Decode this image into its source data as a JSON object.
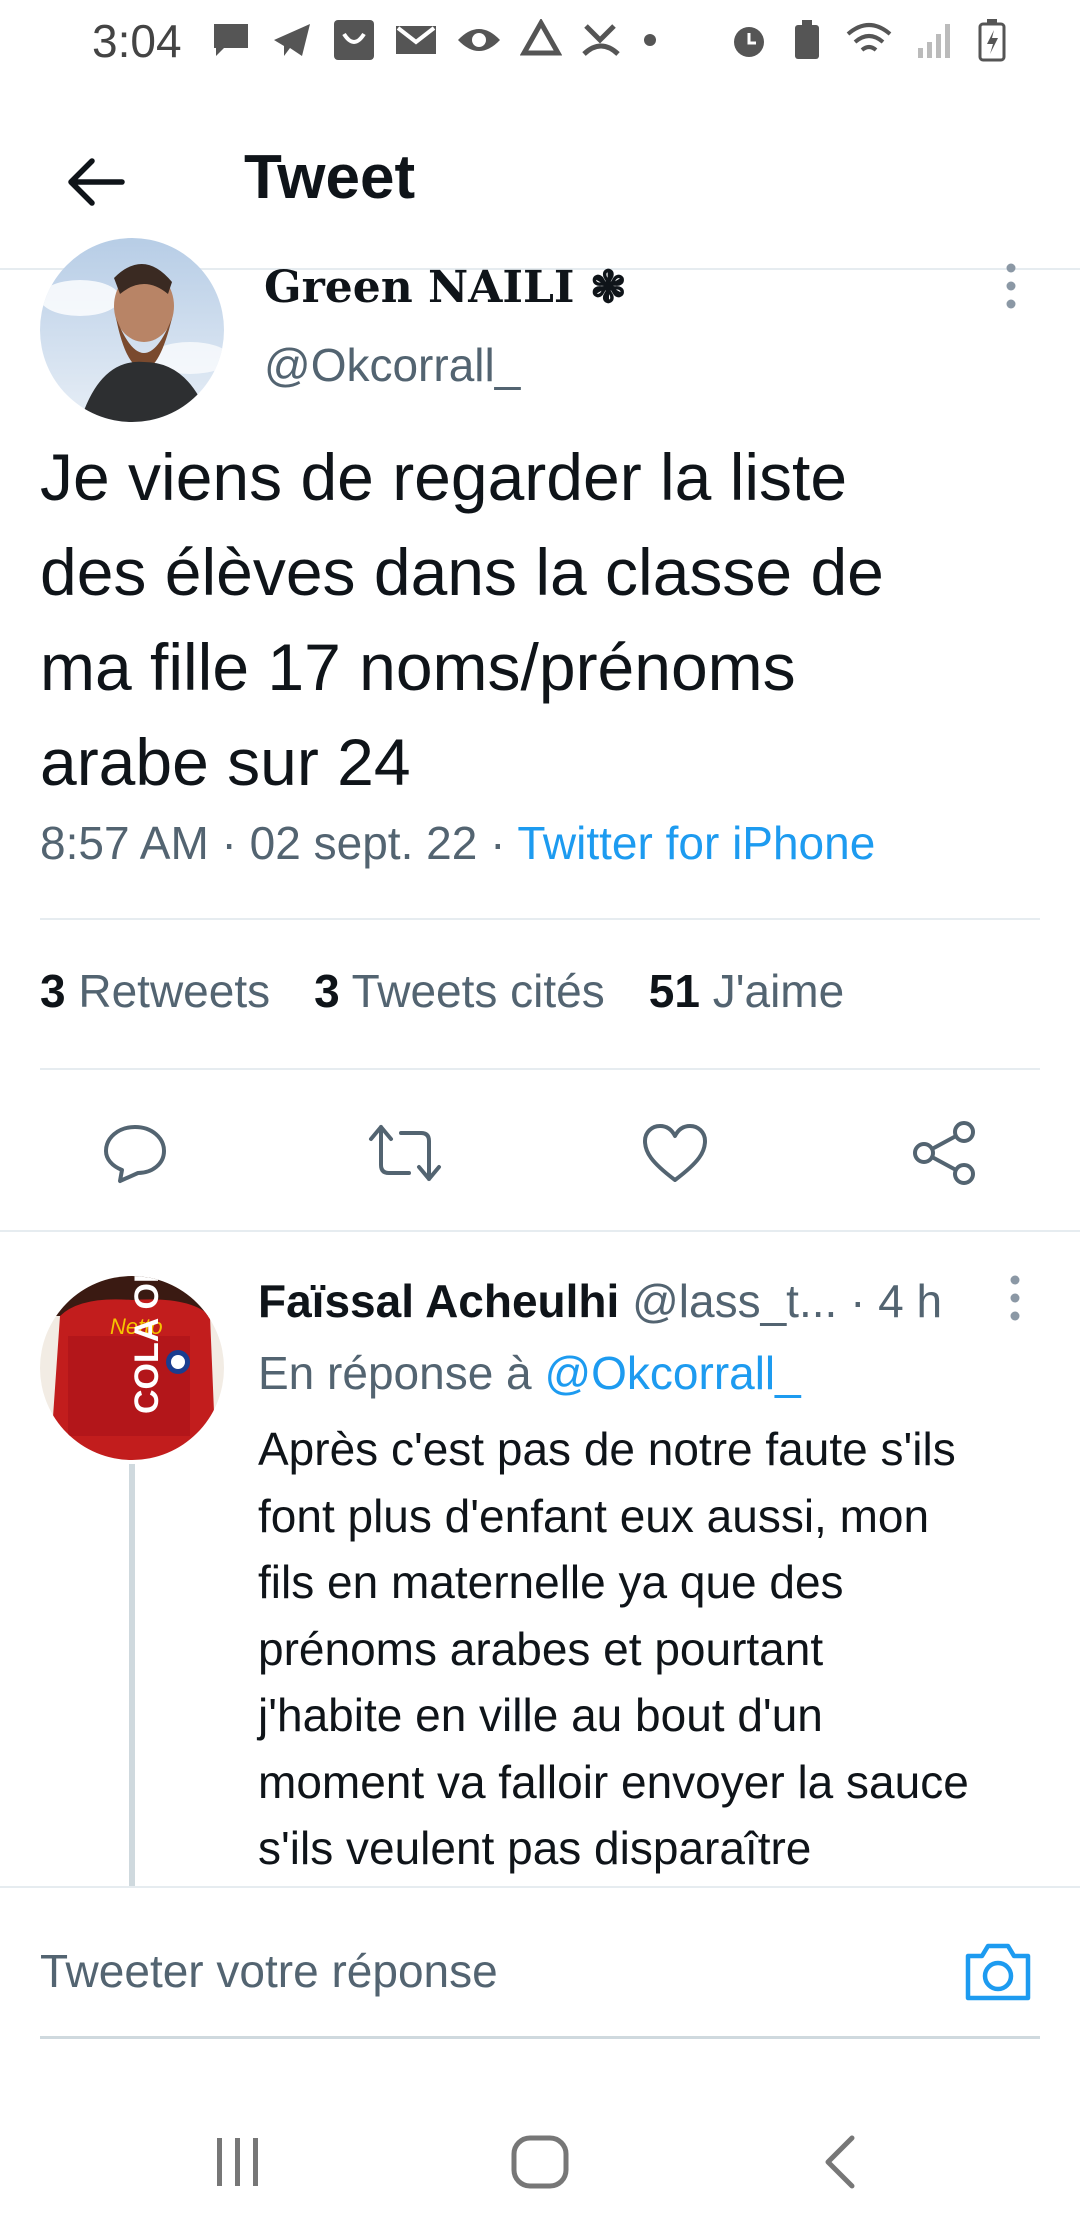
{
  "status_bar": {
    "time": "3:04"
  },
  "header": {
    "title": "Tweet"
  },
  "tweet": {
    "author_name": "Green NAILI ❃",
    "author_handle": "@Okcorrall_",
    "text": "Je viens de regarder la liste\ndes élèves dans la classe de\nma fille 17 noms/prénoms\narabe sur 24",
    "time": "8:57 AM",
    "date": "02 sept. 22",
    "separator": " · ",
    "source": "Twitter for iPhone",
    "stats": {
      "retweets_count": "3",
      "retweets_label": "Retweets",
      "quotes_count": "3",
      "quotes_label": "Tweets cités",
      "likes_count": "51",
      "likes_label": "J'aime"
    }
  },
  "reply": {
    "author_name": "Faïssal Acheulhi",
    "author_handle": "@lass_t...",
    "age": "· 4 h",
    "reply_to_label": "En réponse à",
    "reply_to_mention": "@Okcorrall_",
    "text": "Après c'est pas de notre faute s'ils\nfont plus d'enfant eux aussi, mon\nfils en maternelle ya que des\nprénoms arabes et pourtant\nj'habite en ville au bout d'un\nmoment va falloir envoyer la sauce\ns'ils veulent pas disparaître",
    "avatar_text_top": "Netto",
    "avatar_text_main": "COLA ONE"
  },
  "composer": {
    "placeholder": "Tweeter votre réponse"
  },
  "colors": {
    "accent": "#1d9bf0",
    "text_primary": "#0f1419",
    "text_secondary": "#536471",
    "divider": "#e6ecf0"
  }
}
